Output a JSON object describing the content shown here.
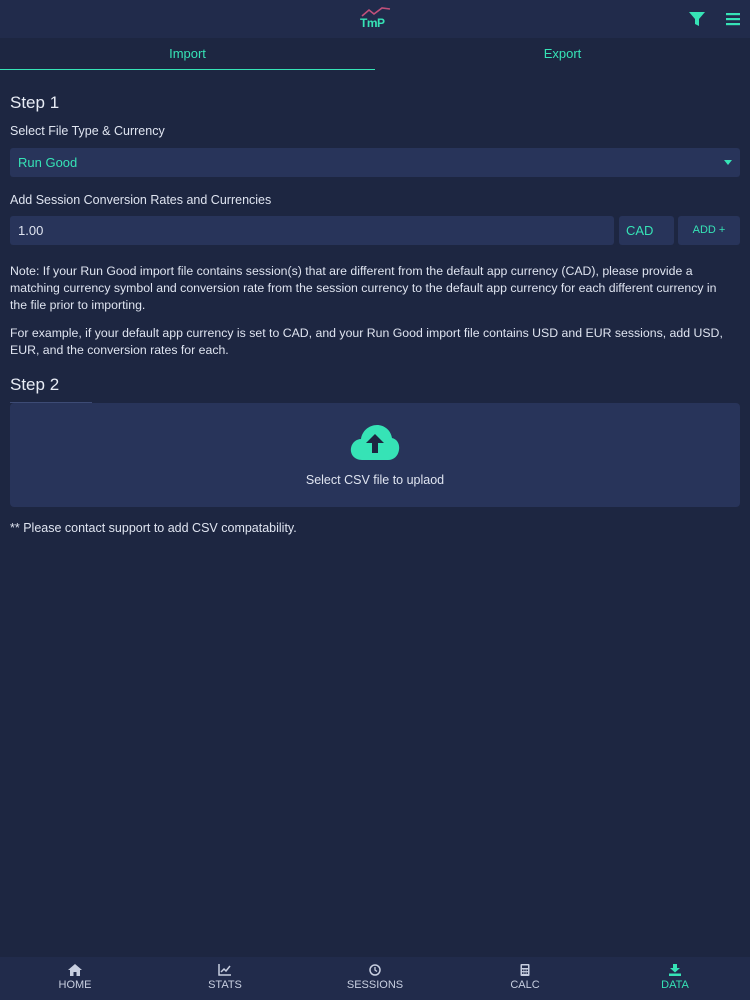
{
  "header": {
    "logo_text": "TmP",
    "filter_icon": "filter-icon",
    "menu_icon": "hamburger-menu-icon"
  },
  "tabs": [
    {
      "label": "Import",
      "active": true
    },
    {
      "label": "Export",
      "active": false
    }
  ],
  "step1": {
    "title": "Step 1",
    "file_type_label": "Select File Type & Currency",
    "file_type_value": "Run Good",
    "conversion_label": "Add Session Conversion Rates and Currencies",
    "rate_value": "1.00",
    "currency_value": "CAD",
    "add_button_label": "ADD +",
    "note_1": "Note: If your Run Good import file contains session(s) that are different from the default app currency (CAD), please provide a matching currency symbol and conversion rate from the session currency to the default app currency for each different currency in the file prior to importing.",
    "note_2": "For example, if your default app currency is set to CAD, and your Run Good import file contains USD and EUR sessions, add USD, EUR, and the conversion rates for each."
  },
  "step2": {
    "title": "Step 2",
    "upload_icon": "cloud-upload-icon",
    "upload_label": "Select CSV file to uplaod",
    "support_note": "** Please contact support to add CSV compatability."
  },
  "bottom_nav": [
    {
      "label": "HOME",
      "icon": "home-icon",
      "active": false
    },
    {
      "label": "STATS",
      "icon": "chart-icon",
      "active": false
    },
    {
      "label": "SESSIONS",
      "icon": "clock-icon",
      "active": false
    },
    {
      "label": "CALC",
      "icon": "calculator-icon",
      "active": false
    },
    {
      "label": "DATA",
      "icon": "download-icon",
      "active": true
    }
  ],
  "colors": {
    "accent": "#36e3b6",
    "background": "#1d2641",
    "panel": "#28345a",
    "bar": "#212b4b"
  }
}
